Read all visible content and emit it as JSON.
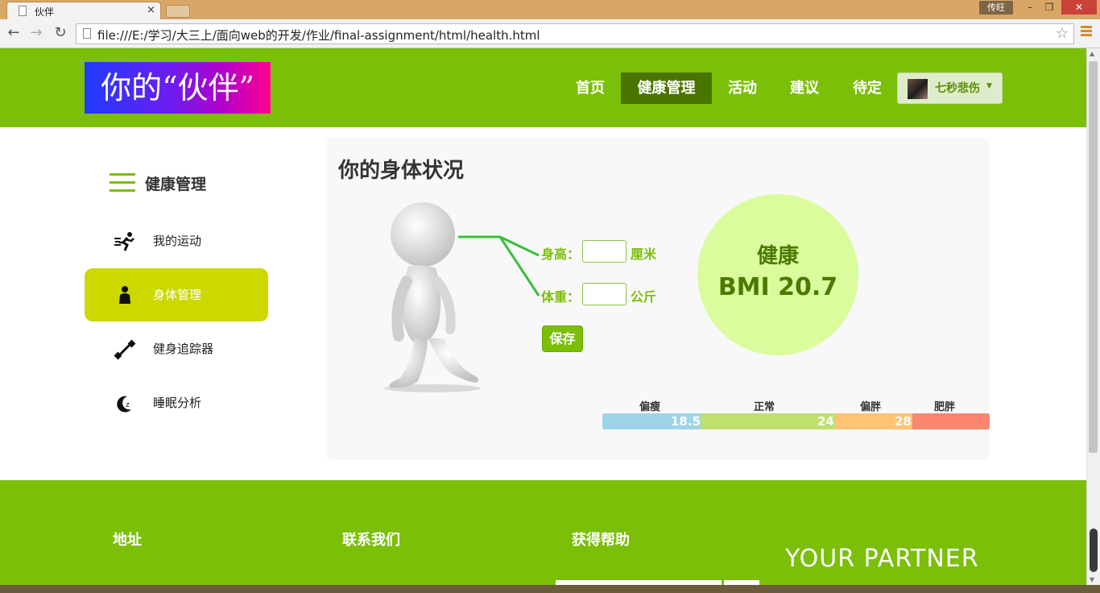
{
  "browser": {
    "tab_title": "伙伴",
    "tab_close": "×",
    "user_badge": "传旺",
    "window_min": "–",
    "window_max": "❐",
    "window_close": "✕",
    "url": "file:///E:/学习/大三上/面向web的开发/作业/final-assignment/html/health.html"
  },
  "header": {
    "logo": "你的“伙伴”",
    "nav": [
      "首页",
      "健康管理",
      "活动",
      "建议",
      "待定"
    ],
    "active_nav": "健康管理",
    "user_name": "七秒悲伤",
    "accent": "#7bbf09",
    "active_bg": "#4a7400"
  },
  "sidebar": {
    "title": "健康管理",
    "items": [
      {
        "label": "我的运动",
        "icon": "runner-icon"
      },
      {
        "label": "身体管理",
        "icon": "body-icon",
        "active": true
      },
      {
        "label": "健身追踪器",
        "icon": "dumbbell-icon"
      },
      {
        "label": "睡眠分析",
        "icon": "moon-sleep-icon"
      }
    ]
  },
  "main": {
    "title": "你的身体状况",
    "height_label": "身高：",
    "height_unit": "厘米",
    "height_value": "",
    "weight_label": "体重：",
    "weight_unit": "公斤",
    "weight_value": "",
    "save_label": "保存",
    "bmi_status": "健康",
    "bmi_text": "BMI 20.7",
    "scale": {
      "labels": [
        "偏瘦",
        "正常",
        "偏胖",
        "肥胖"
      ],
      "thresholds": [
        "18.5",
        "24",
        "28"
      ],
      "colors": [
        "#9ed4e9",
        "#bfe06e",
        "#ffc374",
        "#fd8670"
      ]
    }
  },
  "footer": {
    "address": "地址",
    "contact": "联系我们",
    "help": "获得帮助",
    "brand": "YOUR PARTNER"
  }
}
